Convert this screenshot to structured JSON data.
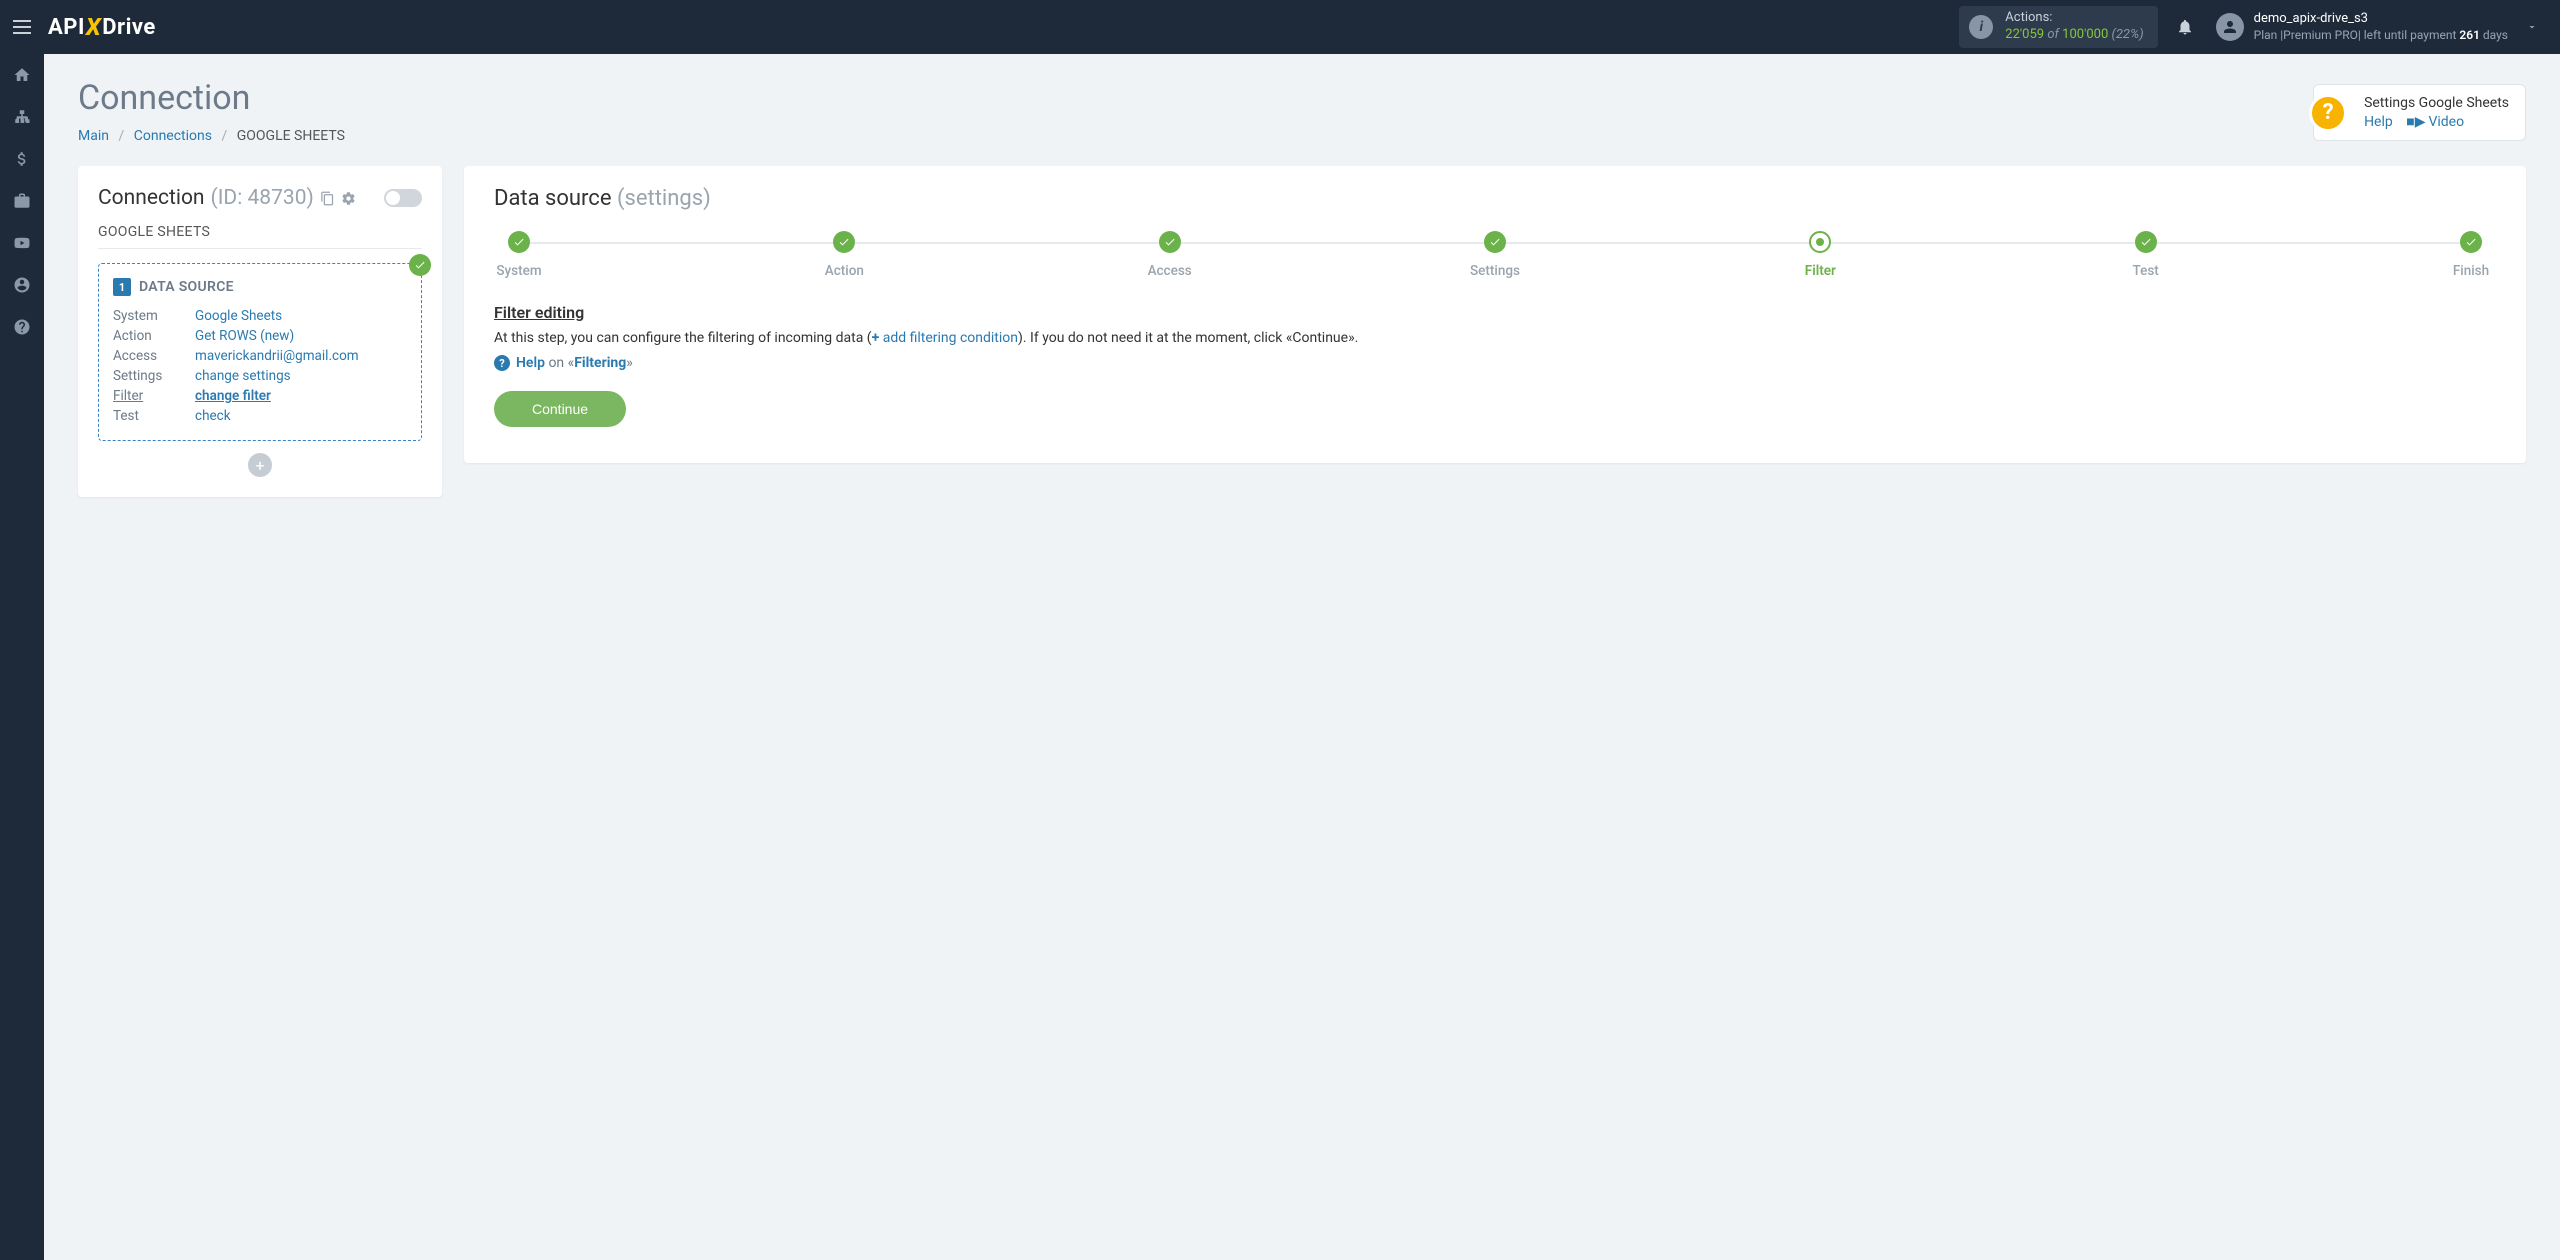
{
  "topbar": {
    "actions": {
      "label": "Actions:",
      "used": "22'059",
      "of": "of",
      "total": "100'000",
      "pct": "(22%)"
    },
    "user": {
      "name": "demo_apix-drive_s3",
      "plan_prefix": "Plan |Premium PRO| left until payment ",
      "plan_days": "261",
      "plan_suffix": " days"
    },
    "logo": {
      "api": "API",
      "x": "X",
      "drive": "Drive"
    }
  },
  "page": {
    "title": "Connection",
    "breadcrumb": {
      "main": "Main",
      "connections": "Connections",
      "current": "GOOGLE SHEETS"
    }
  },
  "helpbox": {
    "title": "Settings Google Sheets",
    "help": "Help",
    "video": "Video"
  },
  "left": {
    "conn_label": "Connection",
    "conn_id": "(ID: 48730)",
    "service": "GOOGLE SHEETS",
    "ds_num": "1",
    "ds_label": "DATA SOURCE",
    "rows": {
      "system": {
        "k": "System",
        "v": "Google Sheets"
      },
      "action": {
        "k": "Action",
        "v": "Get ROWS (new)"
      },
      "access": {
        "k": "Access",
        "v": "maverickandrii@gmail.com"
      },
      "settings": {
        "k": "Settings",
        "v": "change settings"
      },
      "filter": {
        "k": "Filter",
        "v": "change filter"
      },
      "test": {
        "k": "Test",
        "v": "check"
      }
    }
  },
  "right": {
    "title": "Data source",
    "subtitle": "(settings)",
    "steps": [
      "System",
      "Action",
      "Access",
      "Settings",
      "Filter",
      "Test",
      "Finish"
    ],
    "current_step": 4,
    "section_head": "Filter editing",
    "section_text_pre": "At this step, you can configure the filtering of incoming data (",
    "add_link": "add filtering condition",
    "section_text_post": "). If you do not need it at the moment, click «Continue».",
    "help_word": "Help",
    "help_on": " on «",
    "help_topic": "Filtering",
    "help_close": "»",
    "continue": "Continue"
  }
}
